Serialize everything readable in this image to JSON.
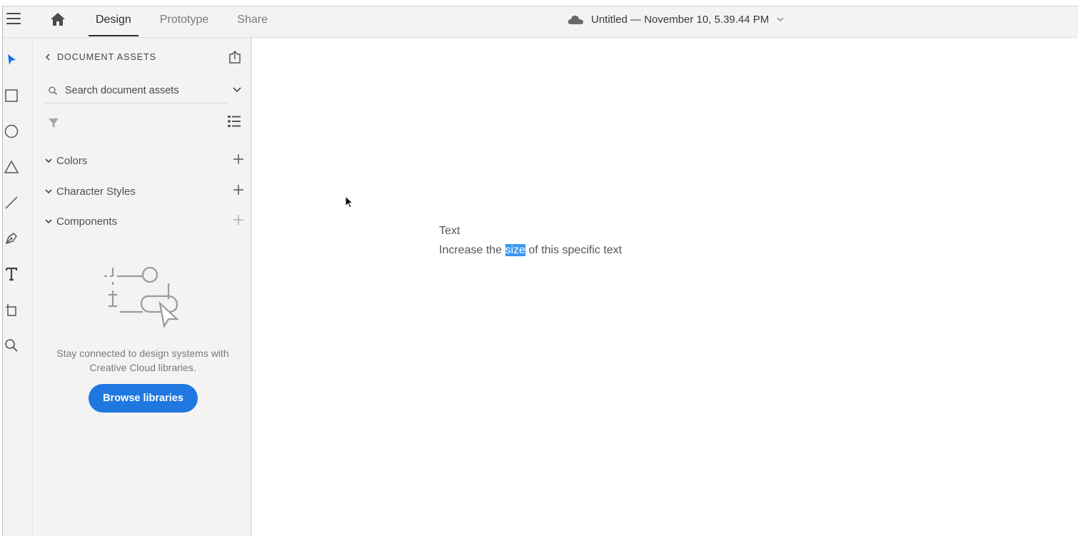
{
  "header": {
    "menu_icon": "hamburger-icon",
    "home_icon": "home-icon",
    "tabs": [
      {
        "label": "Design",
        "active": true
      },
      {
        "label": "Prototype",
        "active": false
      },
      {
        "label": "Share",
        "active": false
      }
    ],
    "doc_title": "Untitled — November 10, 5.39.44 PM"
  },
  "toolbar": {
    "tools": [
      "select-tool",
      "rectangle-tool",
      "ellipse-tool",
      "polygon-tool",
      "line-tool",
      "pen-tool",
      "text-tool",
      "artboard-tool",
      "zoom-tool"
    ],
    "active_tool": "select-tool",
    "accent": "#1473e6"
  },
  "assets": {
    "header": "DOCUMENT ASSETS",
    "search_placeholder": "Search document assets",
    "sections": [
      {
        "label": "Colors"
      },
      {
        "label": "Character Styles"
      },
      {
        "label": "Components"
      }
    ],
    "hint": "Stay connected to design systems with Creative Cloud libraries.",
    "browse_label": "Browse libraries",
    "browse_color": "#1f78e0"
  },
  "canvas": {
    "text_title": "Text",
    "text_before": "Increase the ",
    "text_selected": "size",
    "text_after": " of this specific text",
    "selection_color": "#3a97f3"
  }
}
